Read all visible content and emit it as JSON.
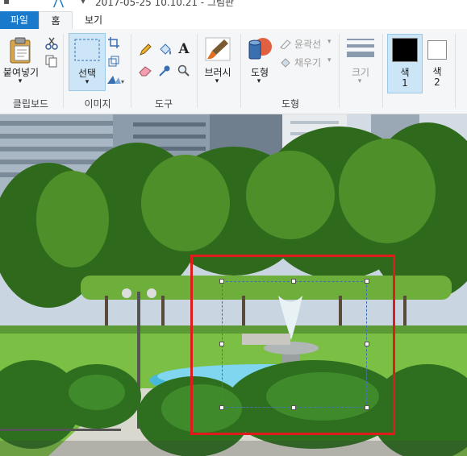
{
  "window": {
    "title": "2017-05-25 10.10.21 - 그림판"
  },
  "tabs": [
    {
      "label": "파일"
    },
    {
      "label": "홈"
    },
    {
      "label": "보기"
    }
  ],
  "ribbon": {
    "clipboard": {
      "paste_label": "붙여넣기",
      "group_label": "클립보드"
    },
    "image": {
      "select_label": "선택",
      "group_label": "이미지"
    },
    "tools": {
      "group_label": "도구"
    },
    "brushes": {
      "label": "브러시"
    },
    "shapes": {
      "shapes_label": "도형",
      "outline_label": "윤곽선",
      "fill_label": "채우기",
      "group_label": "도형"
    },
    "size": {
      "label": "크기"
    },
    "colors": {
      "color1_label": "색",
      "color1_num": "1",
      "color2_label": "색",
      "color2_num": "2",
      "color1_value": "#000000",
      "color2_value": "#ffffff"
    }
  },
  "canvas": {
    "selection_color": "#e01b1b"
  }
}
